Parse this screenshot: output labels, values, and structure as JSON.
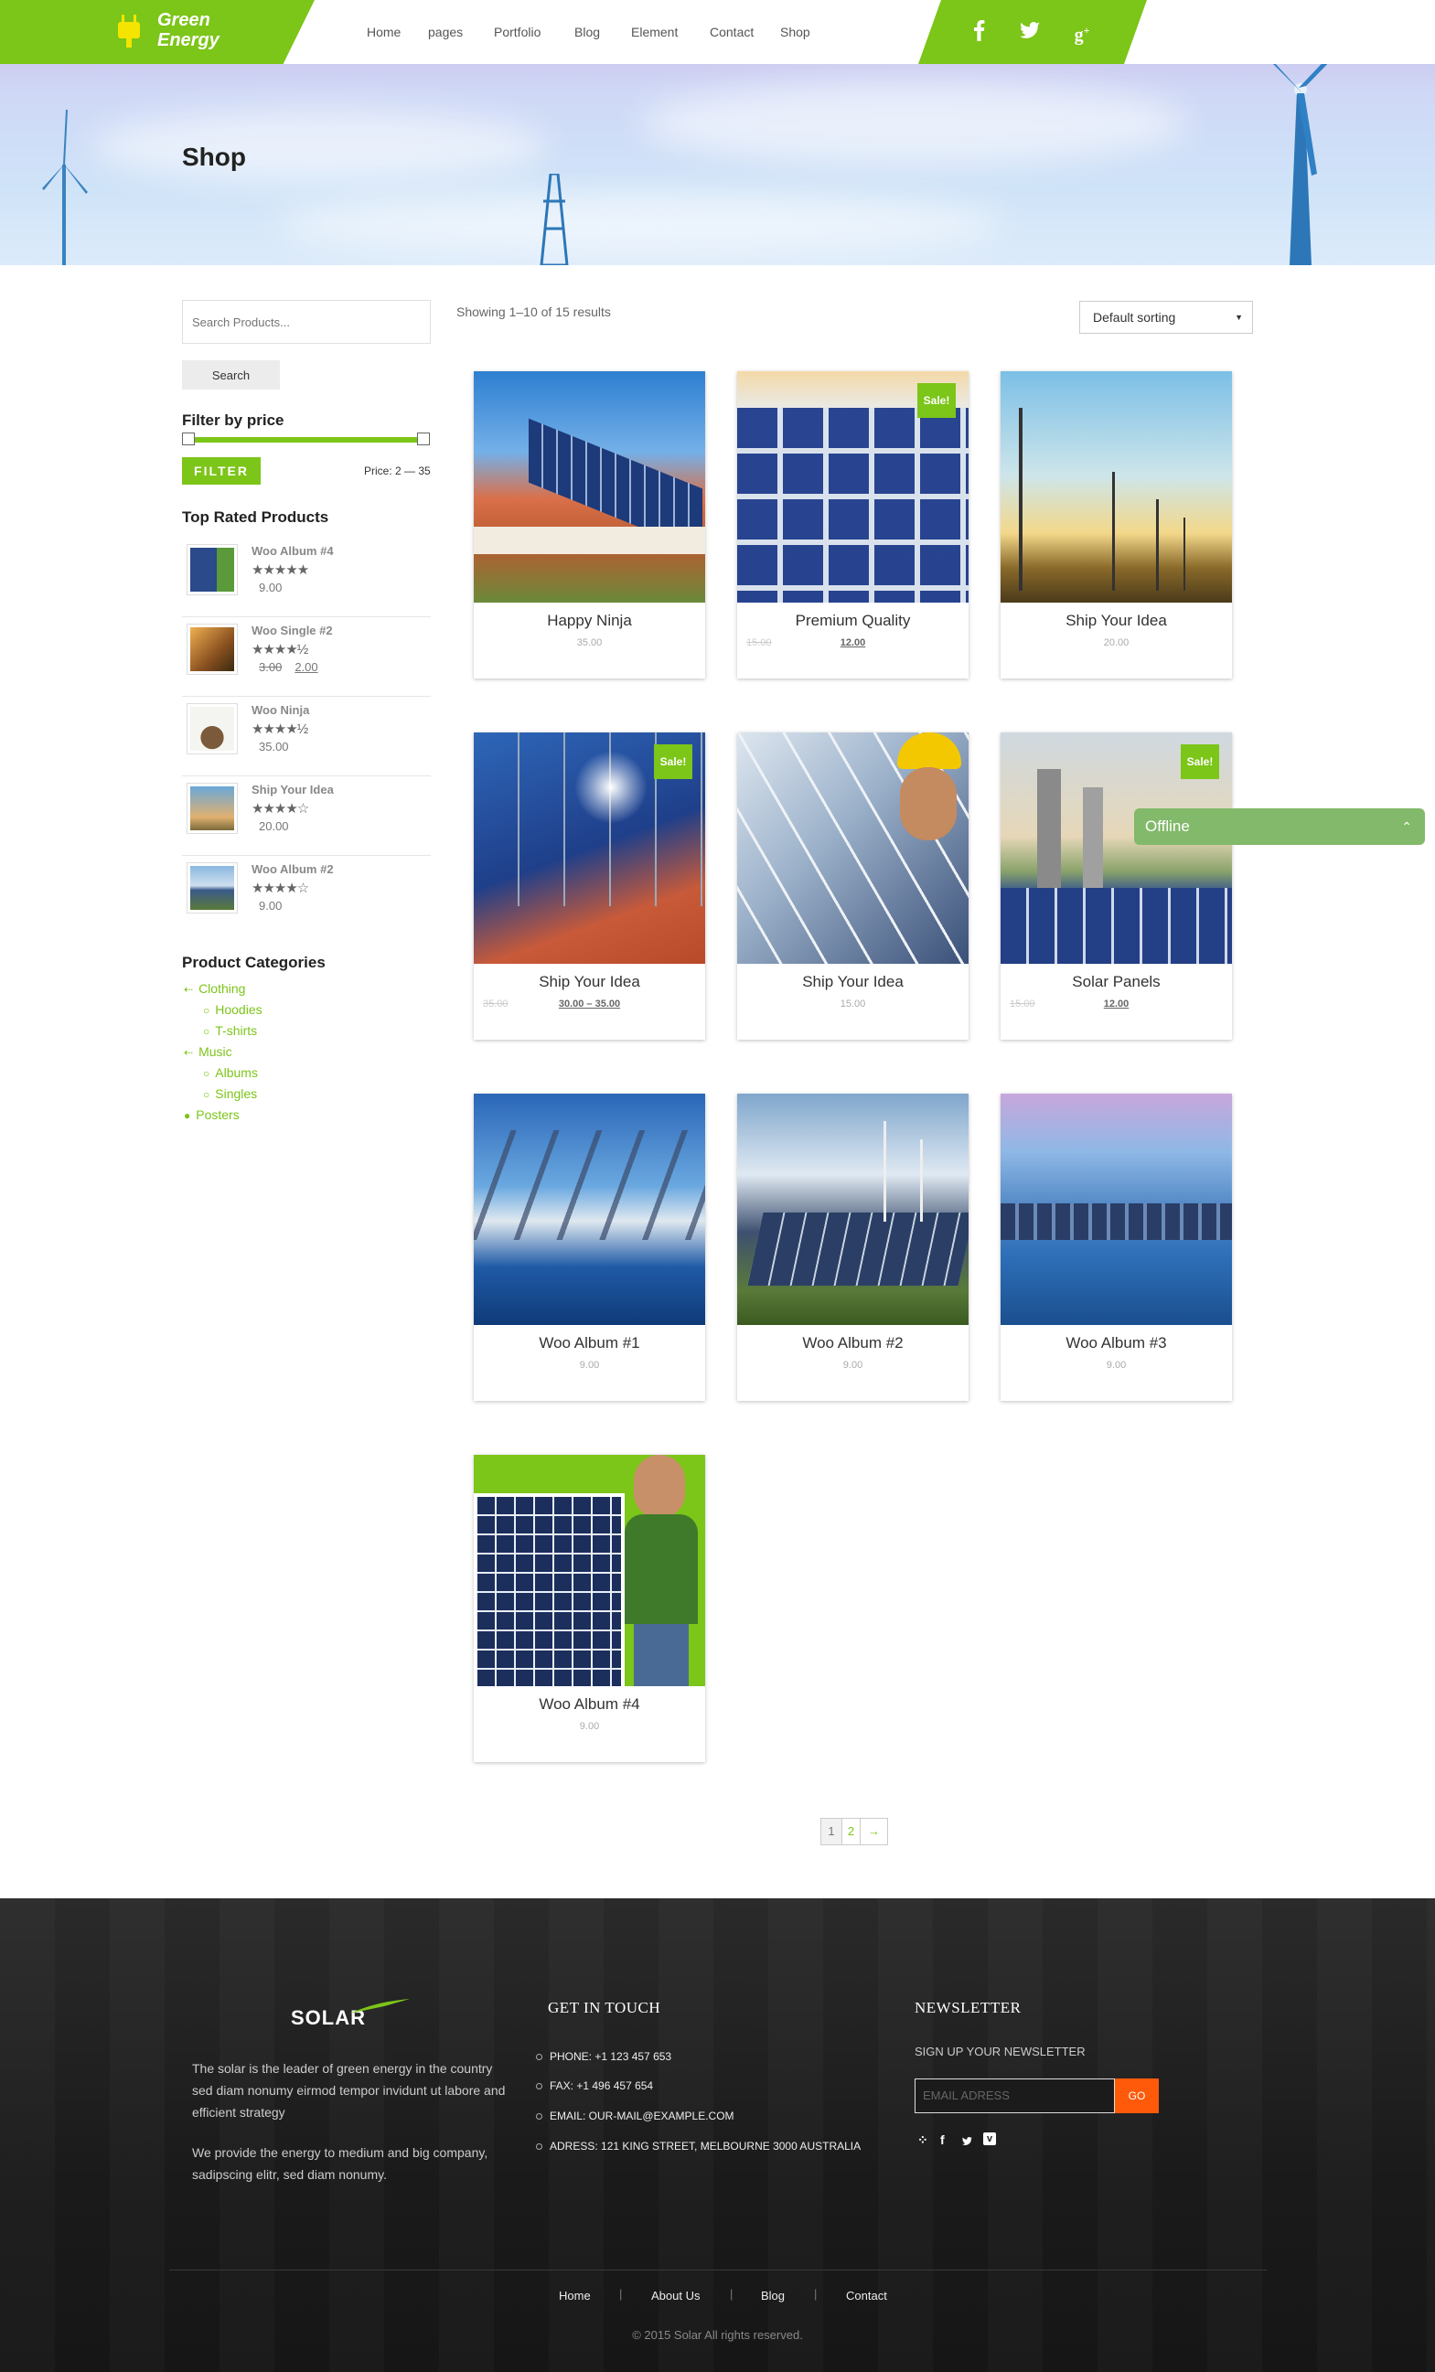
{
  "brand": {
    "name_line1": "Green",
    "name_line2": "Energy"
  },
  "nav": {
    "items": [
      "Home",
      "pages",
      "Portfolio",
      "Blog",
      "Element",
      "Contact",
      "Shop"
    ]
  },
  "social": {
    "icons": [
      "facebook-icon",
      "twitter-icon",
      "google-plus-icon"
    ]
  },
  "page": {
    "title": "Shop"
  },
  "sidebar": {
    "search_placeholder": "Search Products...",
    "search_button": "Search",
    "filter_heading": "Filter by price",
    "filter_button": "FILTER",
    "price_label": "Price: 2 — 35",
    "top_rated_heading": "Top Rated Products",
    "top_rated": [
      {
        "name": "Woo Album #4",
        "stars": "★★★★★",
        "price": "9.00"
      },
      {
        "name": "Woo Single #2",
        "stars": "★★★★½",
        "old_price": "3.00",
        "price": "2.00"
      },
      {
        "name": "Woo Ninja",
        "stars": "★★★★½",
        "price": "35.00"
      },
      {
        "name": "Ship Your Idea",
        "stars": "★★★★☆",
        "price": "20.00"
      },
      {
        "name": "Woo Album #2",
        "stars": "★★★★☆",
        "price": "9.00"
      }
    ],
    "categories_heading": "Product Categories",
    "categories": {
      "clothing": "Clothing",
      "hoodies": "Hoodies",
      "tshirts": "T-shirts",
      "music": "Music",
      "albums": "Albums",
      "singles": "Singles",
      "posters": "Posters"
    }
  },
  "shop": {
    "result_count": "Showing 1–10 of 15 results",
    "sort_value": "Default sorting",
    "sale_label": "Sale!",
    "products": [
      {
        "title": "Happy Ninja",
        "price": "35.00"
      },
      {
        "title": "Premium Quality",
        "old_price": "15.00",
        "price": "12.00"
      },
      {
        "title": "Ship Your Idea",
        "price": "20.00"
      },
      {
        "title": "Ship Your Idea",
        "old_price": "35.00",
        "price": "30.00 – 35.00"
      },
      {
        "title": "Ship Your Idea",
        "price": "15.00"
      },
      {
        "title": "Solar Panels",
        "old_price": "15.00",
        "price": "12.00"
      },
      {
        "title": "Woo Album #1",
        "price": "9.00"
      },
      {
        "title": "Woo Album #2",
        "price": "9.00"
      },
      {
        "title": "Woo Album #3",
        "price": "9.00"
      },
      {
        "title": "Woo Album #4",
        "price": "9.00"
      }
    ],
    "pagination": {
      "page1": "1",
      "page2": "2",
      "next": "→"
    }
  },
  "chat": {
    "status": "Offline"
  },
  "footer": {
    "logo": "SOLAR",
    "about_1": "The solar is the leader of green energy in the country sed diam nonumy eirmod tempor invidunt ut labore and efficient strategy",
    "about_2": "We provide the energy to medium and big company, sadipscing elitr, sed diam nonumy.",
    "contact_heading": "GET IN TOUCH",
    "phone": "PHONE: +1 123 457 653",
    "fax": "FAX: +1 496 457 654",
    "email": "EMAIL: OUR-MAIL@EXAMPLE.COM",
    "address": "ADRESS: 121 KING STREET, MELBOURNE 3000 AUSTRALIA",
    "newsletter_heading": "NEWSLETTER",
    "newsletter_sub": "SIGN UP YOUR NEWSLETTER",
    "newsletter_placeholder": "EMAIL ADRESS",
    "newsletter_button": "GO",
    "nav": [
      "Home",
      "About Us",
      "Blog",
      "Contact"
    ],
    "copyright": "© 2015 Solar All rights reserved."
  },
  "colors": {
    "brand_green": "#7cc519",
    "go_orange": "#ff5a0a",
    "chat_green": "#82b96a"
  }
}
